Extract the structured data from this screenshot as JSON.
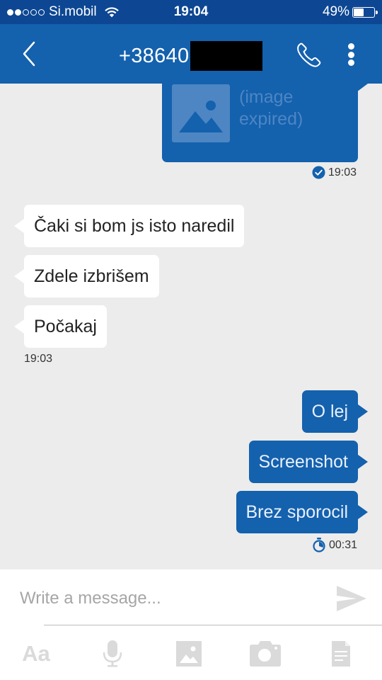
{
  "status_bar": {
    "signal_strength": 2,
    "signal_max": 5,
    "carrier": "Si.mobil",
    "time": "19:04",
    "battery_percent_label": "49%",
    "battery_level": 0.49,
    "icons": [
      "wifi-icon",
      "battery-icon"
    ]
  },
  "header": {
    "back_icon": "chevron-left-icon",
    "title": "+38640",
    "title_redacted": true,
    "call_icon": "phone-icon",
    "menu_icon": "more-vertical-icon"
  },
  "colors": {
    "status_bar_bg": "#0d4793",
    "header_bg": "#1461ae",
    "outgoing_bubble": "#1461ae",
    "incoming_bubble": "#ffffff",
    "conversation_bg": "#ececec",
    "placeholder_image": "#4d86c3"
  },
  "messages": [
    {
      "direction": "out",
      "type": "image",
      "text": "(image\nexpired)",
      "icon": "image-icon"
    },
    {
      "direction": "out",
      "type": "meta",
      "status_icon": "check-circle-icon",
      "time": "19:03"
    },
    {
      "direction": "in",
      "type": "text",
      "text": "Čaki si bom js isto naredil"
    },
    {
      "direction": "in",
      "type": "text",
      "text": "Zdele izbrišem"
    },
    {
      "direction": "in",
      "type": "text",
      "text": "Počakaj"
    },
    {
      "direction": "in",
      "type": "meta",
      "time": "19:03"
    },
    {
      "direction": "out",
      "type": "text",
      "text": "O lej"
    },
    {
      "direction": "out",
      "type": "text",
      "text": "Screenshot"
    },
    {
      "direction": "out",
      "type": "text",
      "text": "Brez sporocil"
    },
    {
      "direction": "out",
      "type": "meta",
      "status_icon": "timer-icon",
      "time": "00:31"
    }
  ],
  "composer": {
    "placeholder": "Write a message...",
    "value": "",
    "send_icon": "send-icon",
    "tools": [
      {
        "name": "text-format",
        "label": "Aa",
        "icon": "text-format-icon"
      },
      {
        "name": "voice",
        "icon": "microphone-icon"
      },
      {
        "name": "gallery",
        "icon": "image-icon"
      },
      {
        "name": "camera",
        "icon": "camera-icon"
      },
      {
        "name": "document",
        "icon": "document-icon"
      }
    ]
  }
}
